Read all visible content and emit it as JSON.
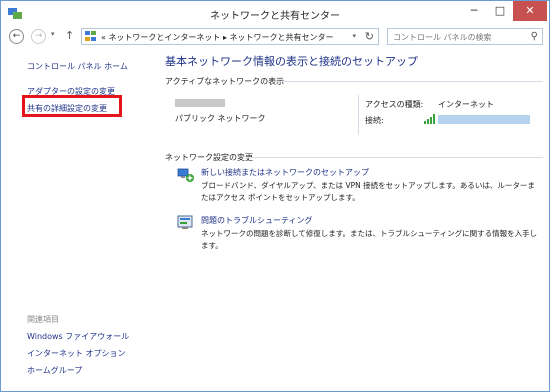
{
  "window": {
    "title": "ネットワークと共有センター",
    "minimize": "─",
    "maximize": "□",
    "close": "✕"
  },
  "nav": {
    "back": "←",
    "forward": "→",
    "up": "↑",
    "dropdown": "▾",
    "refresh": "↻",
    "breadcrumb": "« ネットワークとインターネット ▸ ネットワークと共有センター",
    "search_placeholder": "コントロール パネルの検索",
    "search_icon_glyph": "⚲"
  },
  "sidebar": {
    "home": "コントロール パネル ホーム",
    "adapter": "アダプターの設定の変更",
    "advanced": "共有の詳細設定の変更",
    "highlight_color": "#e8141b",
    "related_heading": "関連項目",
    "related": [
      "Windows ファイアウォール",
      "インターネット オプション",
      "ホームグループ"
    ]
  },
  "main": {
    "title": "基本ネットワーク情報の表示と接続のセットアップ",
    "active_heading": "アクティブなネットワークの表示",
    "network_type": "パブリック ネットワーク",
    "access_label": "アクセスの種類:",
    "access_value": "インターネット",
    "connection_label": "接続:",
    "settings_heading": "ネットワーク設定の変更",
    "tasks": [
      {
        "icon": "network-setup-icon",
        "link": "新しい接続またはネットワークのセットアップ",
        "desc": "ブロードバンド、ダイヤルアップ、または VPN 接続をセットアップします。あるいは、ルーターまたはアクセス ポイントをセットアップします。"
      },
      {
        "icon": "troubleshoot-icon",
        "link": "問題のトラブルシューティング",
        "desc": "ネットワークの問題を診断して修復します。または、トラブルシューティングに関する情報を入手します。"
      }
    ]
  },
  "colors": {
    "link": "#1e3287",
    "close_button": "#c75050"
  }
}
